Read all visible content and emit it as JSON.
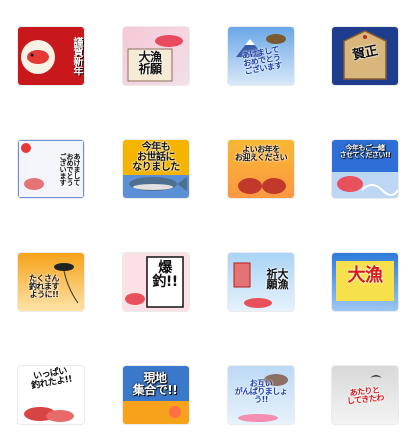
{
  "stickers": [
    {
      "label": "謹賀新年"
    },
    {
      "label": "大漁\n祈願"
    },
    {
      "label": "あけまして\nおめでとう\nございます"
    },
    {
      "label": "賀正"
    },
    {
      "label": "あけまして\nおめでとう\nございます"
    },
    {
      "label": "今年も\nお世話に\nなりました"
    },
    {
      "label": "よいお年を\nお迎えください"
    },
    {
      "label": "今年もご一緒\nさせてください!!"
    },
    {
      "label": "たくさん\n釣れます\nように!!"
    },
    {
      "label": "爆釣!!"
    },
    {
      "label": "大漁\n祈願"
    },
    {
      "label": "大漁"
    },
    {
      "label": "いっぱい\n釣れたよ!!"
    },
    {
      "label": "現地\n集合で!!"
    },
    {
      "label": "お互い\nがんばりましょう!!"
    },
    {
      "label": "あたりと\nしてきたわ"
    }
  ]
}
